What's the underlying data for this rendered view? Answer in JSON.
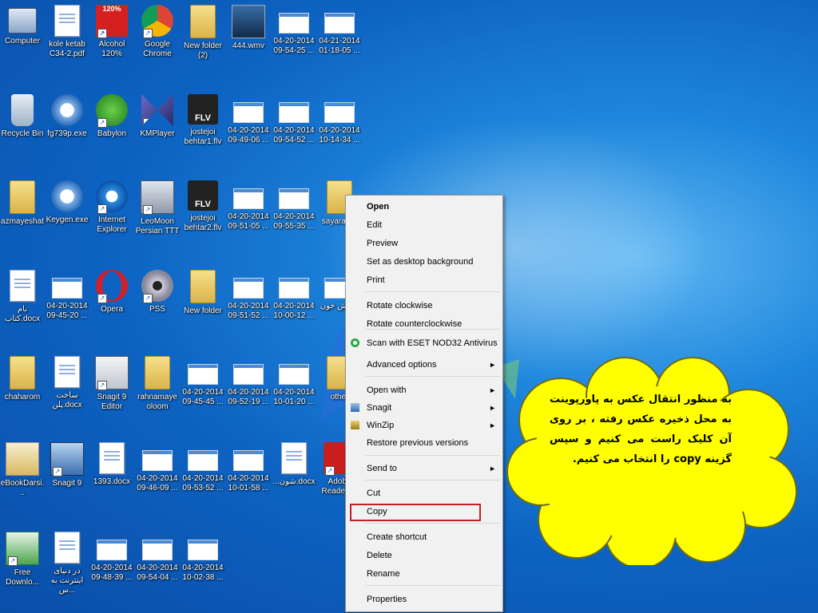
{
  "desktop_icons": [
    {
      "label": "Computer",
      "glyph": "computer-icon",
      "shortcut": false
    },
    {
      "label": "kole ketab\nC34-2.pdf",
      "glyph": "pdf-file-icon",
      "shortcut": false
    },
    {
      "label": "Alcohol\n120%",
      "glyph": "alcohol-120-icon",
      "shortcut": true
    },
    {
      "label": "Google\nChrome",
      "glyph": "chrome-icon",
      "shortcut": true
    },
    {
      "label": "New folder\n(2)",
      "glyph": "folder-icon",
      "shortcut": false
    },
    {
      "label": "444.wmv",
      "glyph": "video-file-icon",
      "shortcut": false
    },
    {
      "label": "04-20-2014\n09-54-25 ...",
      "glyph": "image-file-icon",
      "shortcut": false
    },
    {
      "label": "04-21-2014\n01-18-05 ...",
      "glyph": "image-file-icon",
      "shortcut": false
    },
    {
      "label": "Recycle Bin",
      "glyph": "recycle-bin-icon",
      "shortcut": false
    },
    {
      "label": "fg739p.exe",
      "glyph": "exe-file-icon",
      "shortcut": false
    },
    {
      "label": "Babylon",
      "glyph": "babylon-icon",
      "shortcut": true
    },
    {
      "label": "KMPlayer",
      "glyph": "kmplayer-icon",
      "shortcut": true
    },
    {
      "label": "jostejoi\nbehtar1.flv",
      "glyph": "flv-file-icon",
      "shortcut": false
    },
    {
      "label": "04-20-2014\n09-49-06 ...",
      "glyph": "image-file-icon",
      "shortcut": false
    },
    {
      "label": "04-20-2014\n09-54-52 ...",
      "glyph": "image-file-icon",
      "shortcut": false
    },
    {
      "label": "04-20-2014\n10-14-34 ...",
      "glyph": "image-file-icon",
      "shortcut": false
    },
    {
      "label": "azmayeshat",
      "glyph": "folder-icon",
      "shortcut": false
    },
    {
      "label": "Keygen.exe",
      "glyph": "exe-file-icon",
      "shortcut": false
    },
    {
      "label": "Internet\nExplorer",
      "glyph": "internet-explorer-icon",
      "shortcut": true
    },
    {
      "label": "LeoMoon\nPersian TTT",
      "glyph": "leomoon-icon",
      "shortcut": true
    },
    {
      "label": "jostejoi\nbehtar2.flv",
      "glyph": "flv-file-icon",
      "shortcut": false
    },
    {
      "label": "04-20-2014\n09-51-05 ...",
      "glyph": "image-file-icon",
      "shortcut": false
    },
    {
      "label": "04-20-2014\n09-55-35 ...",
      "glyph": "image-file-icon",
      "shortcut": false
    },
    {
      "label": "sayarat-...",
      "glyph": "folder-icon",
      "shortcut": false
    },
    {
      "label": "نام کتاب.docx",
      "glyph": "word-document-icon",
      "shortcut": false
    },
    {
      "label": "04-20-2014\n09-45-20 ...",
      "glyph": "image-file-icon",
      "shortcut": false
    },
    {
      "label": "Opera",
      "glyph": "opera-icon",
      "shortcut": true
    },
    {
      "label": "PSS",
      "glyph": "webcam-icon",
      "shortcut": true
    },
    {
      "label": "New folder",
      "glyph": "folder-icon",
      "shortcut": false
    },
    {
      "label": "04-20-2014\n09-51-52 ...",
      "glyph": "image-file-icon",
      "shortcut": false
    },
    {
      "label": "04-20-2014\n10-00-12 ...",
      "glyph": "image-file-icon",
      "shortcut": false
    },
    {
      "label": "گردش خون",
      "glyph": "image-file-icon",
      "shortcut": false
    },
    {
      "label": "chaharom",
      "glyph": "folder-icon",
      "shortcut": false
    },
    {
      "label": "ساخت\nپلن.docx",
      "glyph": "word-document-icon",
      "shortcut": false
    },
    {
      "label": "Snagit 9\nEditor",
      "glyph": "snagit-editor-icon",
      "shortcut": true
    },
    {
      "label": "rahnamaye\noloom",
      "glyph": "folder-icon",
      "shortcut": false
    },
    {
      "label": "04-20-2014\n09-45-45 ...",
      "glyph": "image-file-icon",
      "shortcut": false
    },
    {
      "label": "04-20-2014\n09-52-19 ...",
      "glyph": "image-file-icon",
      "shortcut": false
    },
    {
      "label": "04-20-2014\n10-01-20 ...",
      "glyph": "image-file-icon",
      "shortcut": false
    },
    {
      "label": "other",
      "glyph": "folder-icon",
      "shortcut": false
    },
    {
      "label": "eBookDarsi...",
      "glyph": "ebook-icon",
      "shortcut": false
    },
    {
      "label": "Snagit 9",
      "glyph": "snagit-icon",
      "shortcut": true
    },
    {
      "label": "1393.docx",
      "glyph": "word-document-icon",
      "shortcut": false
    },
    {
      "label": "04-20-2014\n09-46-09 ...",
      "glyph": "image-file-icon",
      "shortcut": false
    },
    {
      "label": "04-20-2014\n09-53-52 ...",
      "glyph": "image-file-icon",
      "shortcut": false
    },
    {
      "label": "04-20-2014\n10-01-58 ...",
      "glyph": "image-file-icon",
      "shortcut": false
    },
    {
      "label": "...شون.docx",
      "glyph": "word-document-icon",
      "shortcut": false
    },
    {
      "label": "Adobe\nReader XI",
      "glyph": "adobe-reader-icon",
      "shortcut": true
    },
    {
      "label": "Free\nDownlo...",
      "glyph": "download-manager-icon",
      "shortcut": true
    },
    {
      "label": "در دنیای\nاینترنت به س...",
      "glyph": "word-document-icon",
      "shortcut": false
    },
    {
      "label": "04-20-2014\n09-48-39 ...",
      "glyph": "image-file-icon",
      "shortcut": false
    },
    {
      "label": "04-20-2014\n09-54-04 ...",
      "glyph": "image-file-icon",
      "shortcut": false
    },
    {
      "label": "04-20-2014\n10-02-38 ...",
      "glyph": "image-file-icon",
      "shortcut": false
    }
  ],
  "context_menu": {
    "items": [
      {
        "label": "Open",
        "bold": true,
        "submenu": false,
        "icon": ""
      },
      {
        "label": "Edit",
        "bold": false,
        "submenu": false,
        "icon": ""
      },
      {
        "label": "Preview",
        "bold": false,
        "submenu": false,
        "icon": ""
      },
      {
        "label": "Set as desktop background",
        "bold": false,
        "submenu": false,
        "icon": ""
      },
      {
        "label": "Print",
        "bold": false,
        "submenu": false,
        "icon": ""
      },
      {
        "label": "Rotate clockwise",
        "bold": false,
        "submenu": false,
        "icon": ""
      },
      {
        "label": "Rotate counterclockwise",
        "bold": false,
        "submenu": false,
        "icon": ""
      },
      {
        "label": "Scan with ESET NOD32 Antivirus",
        "bold": false,
        "submenu": false,
        "icon": "eset-icon"
      },
      {
        "label": "Advanced options",
        "bold": false,
        "submenu": true,
        "icon": ""
      },
      {
        "label": "Open with",
        "bold": false,
        "submenu": true,
        "icon": ""
      },
      {
        "label": "Snagit",
        "bold": false,
        "submenu": true,
        "icon": "snagit-icon"
      },
      {
        "label": "WinZip",
        "bold": false,
        "submenu": true,
        "icon": "winzip-icon"
      },
      {
        "label": "Restore previous versions",
        "bold": false,
        "submenu": false,
        "icon": ""
      },
      {
        "label": "Send to",
        "bold": false,
        "submenu": true,
        "icon": ""
      },
      {
        "label": "Cut",
        "bold": false,
        "submenu": false,
        "icon": ""
      },
      {
        "label": "Copy",
        "bold": false,
        "submenu": false,
        "icon": "",
        "highlighted": true
      },
      {
        "label": "Create shortcut",
        "bold": false,
        "submenu": false,
        "icon": ""
      },
      {
        "label": "Delete",
        "bold": false,
        "submenu": false,
        "icon": ""
      },
      {
        "label": "Rename",
        "bold": false,
        "submenu": false,
        "icon": ""
      },
      {
        "label": "Properties",
        "bold": false,
        "submenu": false,
        "icon": ""
      }
    ],
    "submenu_arrow": "►"
  },
  "callout": {
    "text": "به منظور انتقال عکس به پاورپوینت به محل ذخیره عکس رفته ، بر روی آن کلیک راست می کنیم و سپس گزینه copy را انتخاب می کنیم.",
    "fill": "#ffff00",
    "outline": "#6a6a1a"
  },
  "colors": {
    "highlight_border": "#c0202a"
  }
}
